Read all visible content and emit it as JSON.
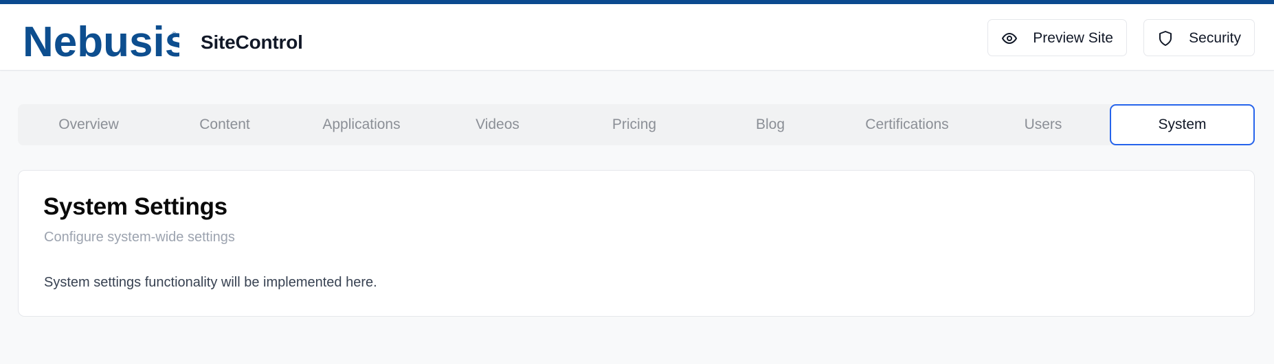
{
  "header": {
    "logo_text": "Nebusis",
    "app_title": "SiteControl",
    "preview_label": "Preview Site",
    "security_label": "Security"
  },
  "tabs": [
    {
      "label": "Overview",
      "active": false
    },
    {
      "label": "Content",
      "active": false
    },
    {
      "label": "Applications",
      "active": false
    },
    {
      "label": "Videos",
      "active": false
    },
    {
      "label": "Pricing",
      "active": false
    },
    {
      "label": "Blog",
      "active": false
    },
    {
      "label": "Certifications",
      "active": false
    },
    {
      "label": "Users",
      "active": false
    },
    {
      "label": "System",
      "active": true
    }
  ],
  "card": {
    "title": "System Settings",
    "subtitle": "Configure system-wide settings",
    "body": "System settings functionality will be implemented here."
  },
  "colors": {
    "accent_bar": "#0b4a8f",
    "active_tab_border": "#2563eb",
    "logo_blue": "#0d4e8f"
  },
  "icons": {
    "preview": "eye-icon",
    "security": "shield-icon"
  }
}
